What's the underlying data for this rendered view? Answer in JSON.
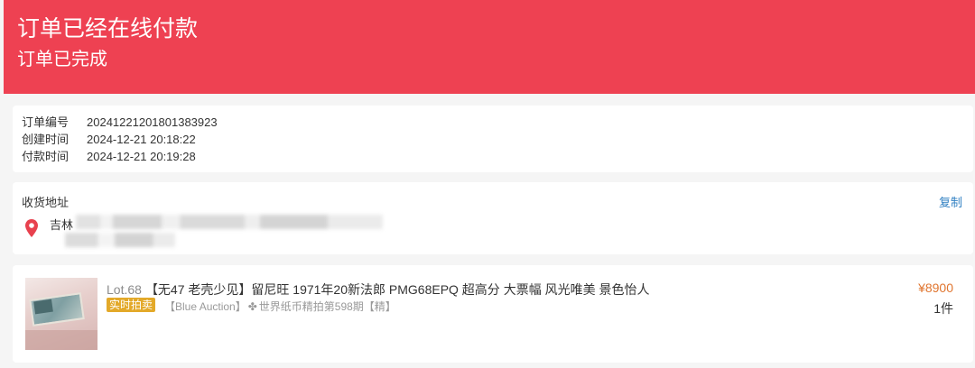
{
  "header": {
    "title": "订单已经在线付款",
    "subtitle": "订单已完成",
    "bg_color": "#ee4152"
  },
  "order_info": {
    "rows": [
      {
        "label": "订单编号",
        "value": "20241221201801383923"
      },
      {
        "label": "创建时间",
        "value": "2024-12-21 20:18:22"
      },
      {
        "label": "付款时间",
        "value": "2024-12-21 20:19:28"
      }
    ]
  },
  "address": {
    "label": "收货地址",
    "copy_label": "复制",
    "province": "吉林",
    "icon": "location-pin-icon"
  },
  "product": {
    "lot": "Lot.68",
    "title": "【无47 老壳少见】留尼旺 1971年20新法郎 PMG68EPQ 超高分 大票幅 风光唯美 景色怡人",
    "badge": "实时拍卖",
    "source_prefix": "【Blue Auction】",
    "source_icon": "✤",
    "source_suffix": "世界纸币精拍第598期【精】",
    "price": "¥8900",
    "quantity": "1件",
    "price_color": "#e0752f",
    "badge_color": "#e3a929"
  }
}
